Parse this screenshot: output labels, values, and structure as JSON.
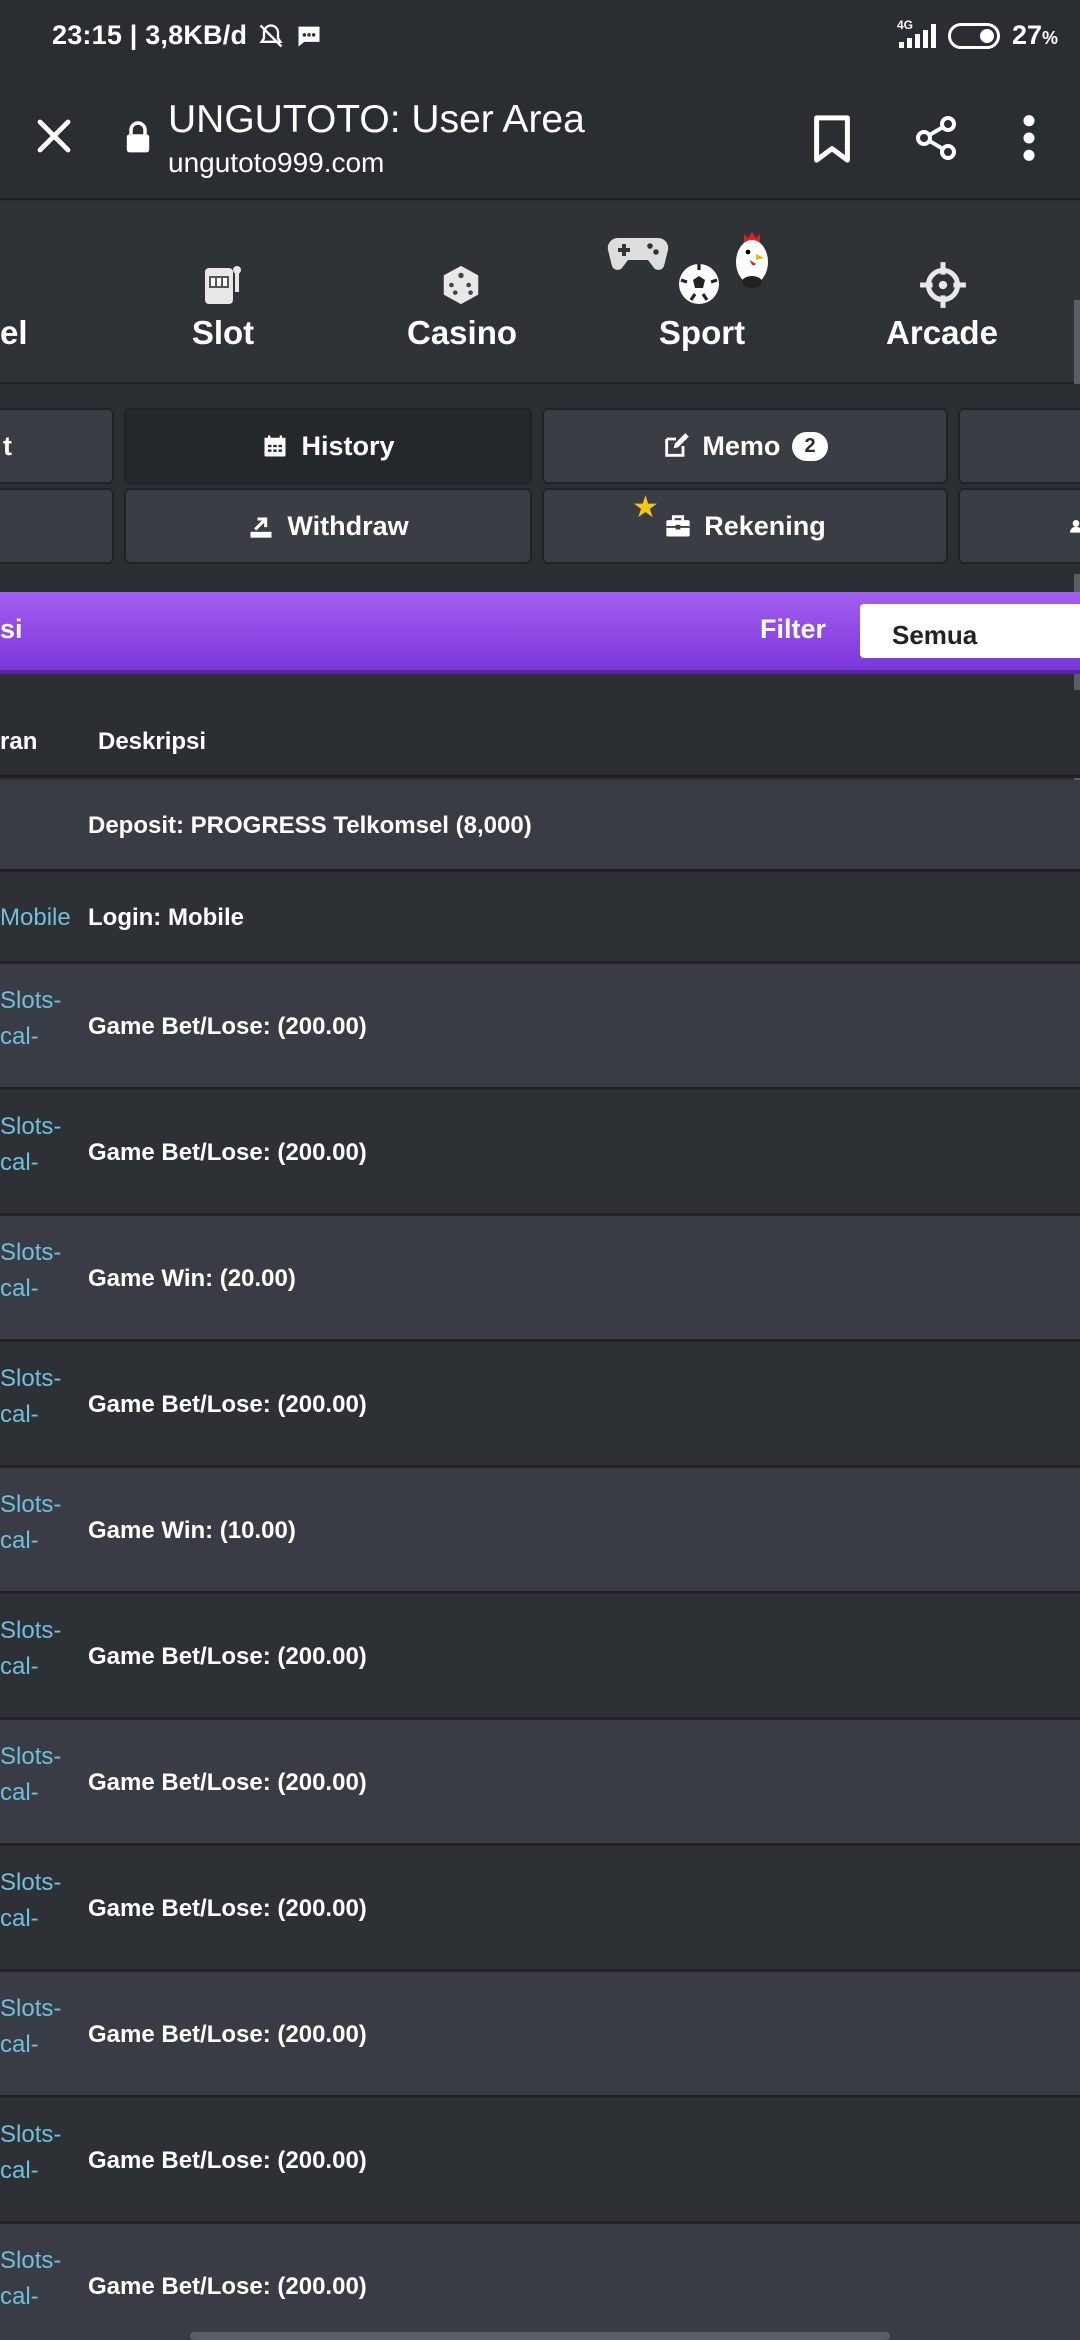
{
  "status_bar": {
    "time_speed": "23:15 | 3,8KB/d",
    "network": "4G",
    "battery": "27",
    "battery_unit": "%",
    "icons": [
      "mute-bell-icon",
      "message-icon",
      "signal-icon",
      "battery-icon"
    ]
  },
  "browser": {
    "title": "UNGUTOTO: User Area",
    "url": "ungutoto999.com",
    "icons": [
      "close-icon",
      "lock-icon",
      "bookmark-icon",
      "share-icon",
      "more-icon"
    ]
  },
  "categories": [
    {
      "label": "el",
      "icon": "partial-icon"
    },
    {
      "label": "Slot",
      "icon": "slot-machine-icon"
    },
    {
      "label": "Casino",
      "icon": "dice-icon"
    },
    {
      "label": "Sport",
      "icon": "gamepad-soccer-rooster-icon"
    },
    {
      "label": "Arcade",
      "icon": "crosshair-icon"
    }
  ],
  "tabs": {
    "row1": [
      {
        "label": "t"
      },
      {
        "label": "History",
        "icon": "calendar-icon"
      },
      {
        "label": "Memo",
        "icon": "edit-icon",
        "badge": "2"
      },
      {
        "label": ""
      }
    ],
    "row2": [
      {
        "label": ""
      },
      {
        "label": "Withdraw",
        "icon": "withdraw-icon"
      },
      {
        "label": "Rekening",
        "icon": "briefcase-icon"
      },
      {
        "label": ""
      }
    ]
  },
  "filter_bar": {
    "left_label": "si",
    "filter_label": "Filter",
    "selected": "Semua"
  },
  "table": {
    "headers": [
      "ran",
      "Deskripsi"
    ],
    "rows": [
      {
        "c1": "",
        "c1b": "",
        "desc": "Deposit: PROGRESS Telkomsel (8,000)"
      },
      {
        "c1": "Mobile",
        "c1b": "",
        "desc": "Login: Mobile"
      },
      {
        "c1": "Slots-",
        "c1b": "cal-",
        "desc": "Game Bet/Lose: (200.00)"
      },
      {
        "c1": "Slots-",
        "c1b": "cal-",
        "desc": "Game Bet/Lose: (200.00)"
      },
      {
        "c1": "Slots-",
        "c1b": "cal-",
        "desc": "Game Win: (20.00)"
      },
      {
        "c1": "Slots-",
        "c1b": "cal-",
        "desc": "Game Bet/Lose: (200.00)"
      },
      {
        "c1": "Slots-",
        "c1b": "cal-",
        "desc": "Game Win: (10.00)"
      },
      {
        "c1": "Slots-",
        "c1b": "cal-",
        "desc": "Game Bet/Lose: (200.00)"
      },
      {
        "c1": "Slots-",
        "c1b": "cal-",
        "desc": "Game Bet/Lose: (200.00)"
      },
      {
        "c1": "Slots-",
        "c1b": "cal-",
        "desc": "Game Bet/Lose: (200.00)"
      },
      {
        "c1": "Slots-",
        "c1b": "cal-",
        "desc": "Game Bet/Lose: (200.00)"
      },
      {
        "c1": "Slots-",
        "c1b": "cal-",
        "desc": "Game Bet/Lose: (200.00)"
      },
      {
        "c1": "Slots-",
        "c1b": "cal-",
        "desc": "Game Bet/Lose: (200.00)"
      }
    ]
  },
  "colors": {
    "accent_purple": "#8b45e6",
    "link_blue": "#6ec0dc",
    "background": "#2b2e33"
  }
}
